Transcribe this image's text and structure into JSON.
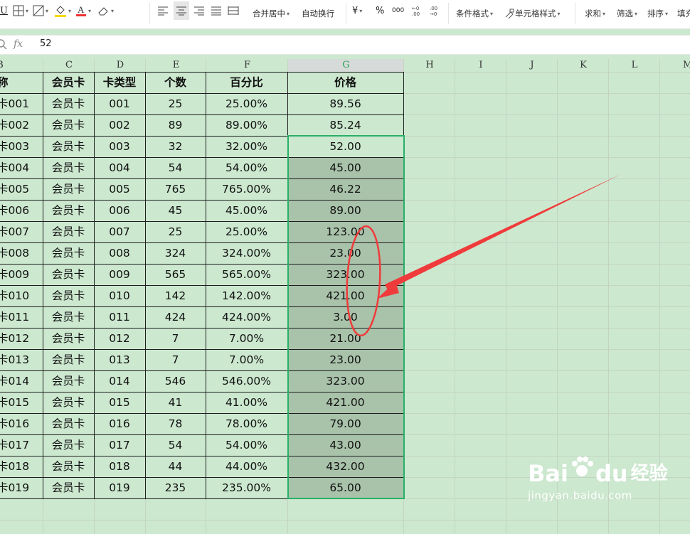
{
  "toolbar": {
    "merge_label": "合并居中",
    "wrap_label": "自动换行",
    "currency_label": "¥",
    "percent_label": "%",
    "thousands_label": "000",
    "cond_format_label": "条件格式",
    "cell_style_label": "单元格样式",
    "sum_label": "求和",
    "filter_label": "筛选",
    "sort_label": "排序",
    "fill_label": "填充"
  },
  "formula_bar": {
    "fx": "fx",
    "value": "52"
  },
  "columns": [
    "B",
    "C",
    "D",
    "E",
    "F",
    "G",
    "H",
    "I",
    "J",
    "K",
    "L",
    "M"
  ],
  "selected_column": "G",
  "headers": {
    "name": "称",
    "card": "会员卡",
    "card_type": "卡类型",
    "count": "个数",
    "percent": "百分比",
    "price": "价格"
  },
  "rows": [
    {
      "name": "卡001",
      "card": "会员卡",
      "card_type": "001",
      "count": "25",
      "percent": "25.00%",
      "price": "89.56"
    },
    {
      "name": "卡002",
      "card": "会员卡",
      "card_type": "002",
      "count": "89",
      "percent": "89.00%",
      "price": "85.24"
    },
    {
      "name": "卡003",
      "card": "会员卡",
      "card_type": "003",
      "count": "32",
      "percent": "32.00%",
      "price": "52.00"
    },
    {
      "name": "卡004",
      "card": "会员卡",
      "card_type": "004",
      "count": "54",
      "percent": "54.00%",
      "price": "45.00"
    },
    {
      "name": "卡005",
      "card": "会员卡",
      "card_type": "005",
      "count": "765",
      "percent": "765.00%",
      "price": "46.22"
    },
    {
      "name": "卡006",
      "card": "会员卡",
      "card_type": "006",
      "count": "45",
      "percent": "45.00%",
      "price": "89.00"
    },
    {
      "name": "卡007",
      "card": "会员卡",
      "card_type": "007",
      "count": "25",
      "percent": "25.00%",
      "price": "123.00"
    },
    {
      "name": "卡008",
      "card": "会员卡",
      "card_type": "008",
      "count": "324",
      "percent": "324.00%",
      "price": "23.00"
    },
    {
      "name": "卡009",
      "card": "会员卡",
      "card_type": "009",
      "count": "565",
      "percent": "565.00%",
      "price": "323.00"
    },
    {
      "name": "卡010",
      "card": "会员卡",
      "card_type": "010",
      "count": "142",
      "percent": "142.00%",
      "price": "421.00"
    },
    {
      "name": "卡011",
      "card": "会员卡",
      "card_type": "011",
      "count": "424",
      "percent": "424.00%",
      "price": "3.00"
    },
    {
      "name": "卡012",
      "card": "会员卡",
      "card_type": "012",
      "count": "7",
      "percent": "7.00%",
      "price": "21.00"
    },
    {
      "name": "卡013",
      "card": "会员卡",
      "card_type": "013",
      "count": "7",
      "percent": "7.00%",
      "price": "23.00"
    },
    {
      "name": "卡014",
      "card": "会员卡",
      "card_type": "014",
      "count": "546",
      "percent": "546.00%",
      "price": "323.00"
    },
    {
      "name": "卡015",
      "card": "会员卡",
      "card_type": "015",
      "count": "41",
      "percent": "41.00%",
      "price": "421.00"
    },
    {
      "name": "卡016",
      "card": "会员卡",
      "card_type": "016",
      "count": "78",
      "percent": "78.00%",
      "price": "79.00"
    },
    {
      "name": "卡017",
      "card": "会员卡",
      "card_type": "017",
      "count": "54",
      "percent": "54.00%",
      "price": "43.00"
    },
    {
      "name": "卡018",
      "card": "会员卡",
      "card_type": "018",
      "count": "44",
      "percent": "44.00%",
      "price": "432.00"
    },
    {
      "name": "卡019",
      "card": "会员卡",
      "card_type": "019",
      "count": "235",
      "percent": "235.00%",
      "price": "65.00"
    }
  ],
  "watermark": {
    "brand": "Bai",
    "brand2": "du",
    "cn": "经验",
    "url": "jingyan.baidu.com"
  },
  "colors": {
    "sheet_bg": "#cce8cf",
    "selection_fill": "#a9c2aa",
    "selection_border": "#29b067",
    "annotation": "#ef3b3b"
  }
}
